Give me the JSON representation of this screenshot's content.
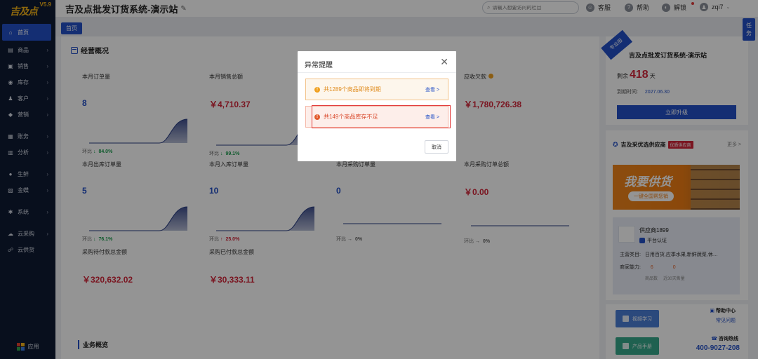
{
  "app": {
    "logo": "吉及点",
    "version": "V5.9",
    "title": "吉及点批发订货系统-演示站"
  },
  "sidebar": {
    "items": [
      {
        "label": "首页",
        "icon": "home-icon",
        "glyph": "⌂",
        "arrow": false
      },
      {
        "label": "商品",
        "icon": "cart-icon",
        "glyph": "▤",
        "arrow": true
      },
      {
        "label": "销售",
        "icon": "sales-icon",
        "glyph": "▣",
        "arrow": true
      },
      {
        "label": "库存",
        "icon": "stock-icon",
        "glyph": "◉",
        "arrow": true
      },
      {
        "label": "客户",
        "icon": "customer-icon",
        "glyph": "♟",
        "arrow": true
      },
      {
        "label": "营销",
        "icon": "marketing-icon",
        "glyph": "◆",
        "arrow": true
      },
      {
        "label": "账务",
        "icon": "finance-icon",
        "glyph": "▦",
        "arrow": true
      },
      {
        "label": "分析",
        "icon": "analysis-icon",
        "glyph": "▥",
        "arrow": true
      },
      {
        "label": "生鲜",
        "icon": "fresh-icon",
        "glyph": "●",
        "arrow": true
      },
      {
        "label": "金蝶",
        "icon": "kingdee-icon",
        "glyph": "▧",
        "arrow": true
      },
      {
        "label": "系统",
        "icon": "system-icon",
        "glyph": "✱",
        "arrow": true
      },
      {
        "label": "云采购",
        "icon": "cloud-purchase-icon",
        "glyph": "☁",
        "arrow": true
      },
      {
        "label": "云供货",
        "icon": "cloud-supply-icon",
        "glyph": "☍",
        "arrow": false
      }
    ],
    "apps_label": "应用"
  },
  "header": {
    "search_placeholder": "请输入想要访问的栏目",
    "service": "客服",
    "help": "帮助",
    "unlock": "解锁",
    "user": "zqi7"
  },
  "tabs": {
    "home": "首页",
    "task": "任务"
  },
  "overview": {
    "title": "经营概况",
    "metrics": [
      {
        "label": "本月订单量",
        "value": "8",
        "color": "blue",
        "cmp": "环比",
        "dir": "down",
        "pct": "84.0%",
        "chart": true
      },
      {
        "label": "本月销售总额",
        "value": "￥4,710.37",
        "color": "red",
        "cmp": "环比",
        "dir": "down",
        "pct": "99.1%",
        "chart": true
      },
      {
        "label": "应收欠款",
        "value": "￥1,780,726.38",
        "color": "red",
        "cmp": "",
        "dir": "",
        "pct": "",
        "chart": false
      },
      {
        "label": "本月出库订单量",
        "value": "5",
        "color": "blue",
        "cmp": "环比",
        "dir": "down",
        "pct": "76.1%",
        "chart": true
      },
      {
        "label": "本月入库订单量",
        "value": "10",
        "color": "blue",
        "cmp": "环比",
        "dir": "up",
        "pct": "25.0%",
        "chart": true
      },
      {
        "label": "本月采购订单量",
        "value": "0",
        "color": "blue",
        "cmp": "环比",
        "dir": "flat",
        "pct": "0%",
        "chart": true
      },
      {
        "label": "本月采购订单总额",
        "value": "￥0.00",
        "color": "red",
        "cmp": "环比",
        "dir": "flat",
        "pct": "0%",
        "chart": true
      },
      {
        "label": "采购待付款总金额",
        "value": "￥320,632.02",
        "color": "red",
        "cmp": "",
        "dir": "",
        "pct": "",
        "chart": false
      },
      {
        "label": "采购已付款总金额",
        "value": "￥30,333.11",
        "color": "red",
        "cmp": "",
        "dir": "",
        "pct": "",
        "chart": false
      }
    ],
    "business_title": "业务概览"
  },
  "promo": {
    "badge": "专业版",
    "title": "吉及点批发订货系统-演示站",
    "remain_label": "剩余",
    "remain_days": "418",
    "remain_unit": "天",
    "expire_label": "到期时间:",
    "expire_date": "2027.06.30",
    "upgrade": "立即升级"
  },
  "supplier": {
    "title": "吉及采优选供应商",
    "badge": "优质供应商",
    "more": "更多 >",
    "banner_main": "我要供货",
    "banner_sub": "一键全国帮您销",
    "name": "供应商1899",
    "verify": "平台认证",
    "category_label": "主营类目:",
    "category": "日用百货,应季水果,新鲜蔬菜,休…",
    "ability_label": "商家能力:",
    "ability_goods": "6",
    "ability_sales": "0",
    "goods_count_label": "商品数",
    "sales_label": "近30天售量"
  },
  "tools": {
    "video": "视频学习",
    "manual": "产品手册",
    "help_center": "帮助中心",
    "faq": "常见问题",
    "hotline_label": "咨询热线",
    "hotline": "400-9027-208"
  },
  "modal": {
    "title": "异常提醒",
    "alert1": "共1289个商品即将到期",
    "alert2": "共149个商品库存不足",
    "view": "查看 >",
    "cancel": "取消"
  },
  "colors": {
    "primary": "#2450c6",
    "sidebar": "#0e1a33",
    "red": "#d3263a",
    "green": "#1d9d4f",
    "warning": "#f0a020"
  }
}
